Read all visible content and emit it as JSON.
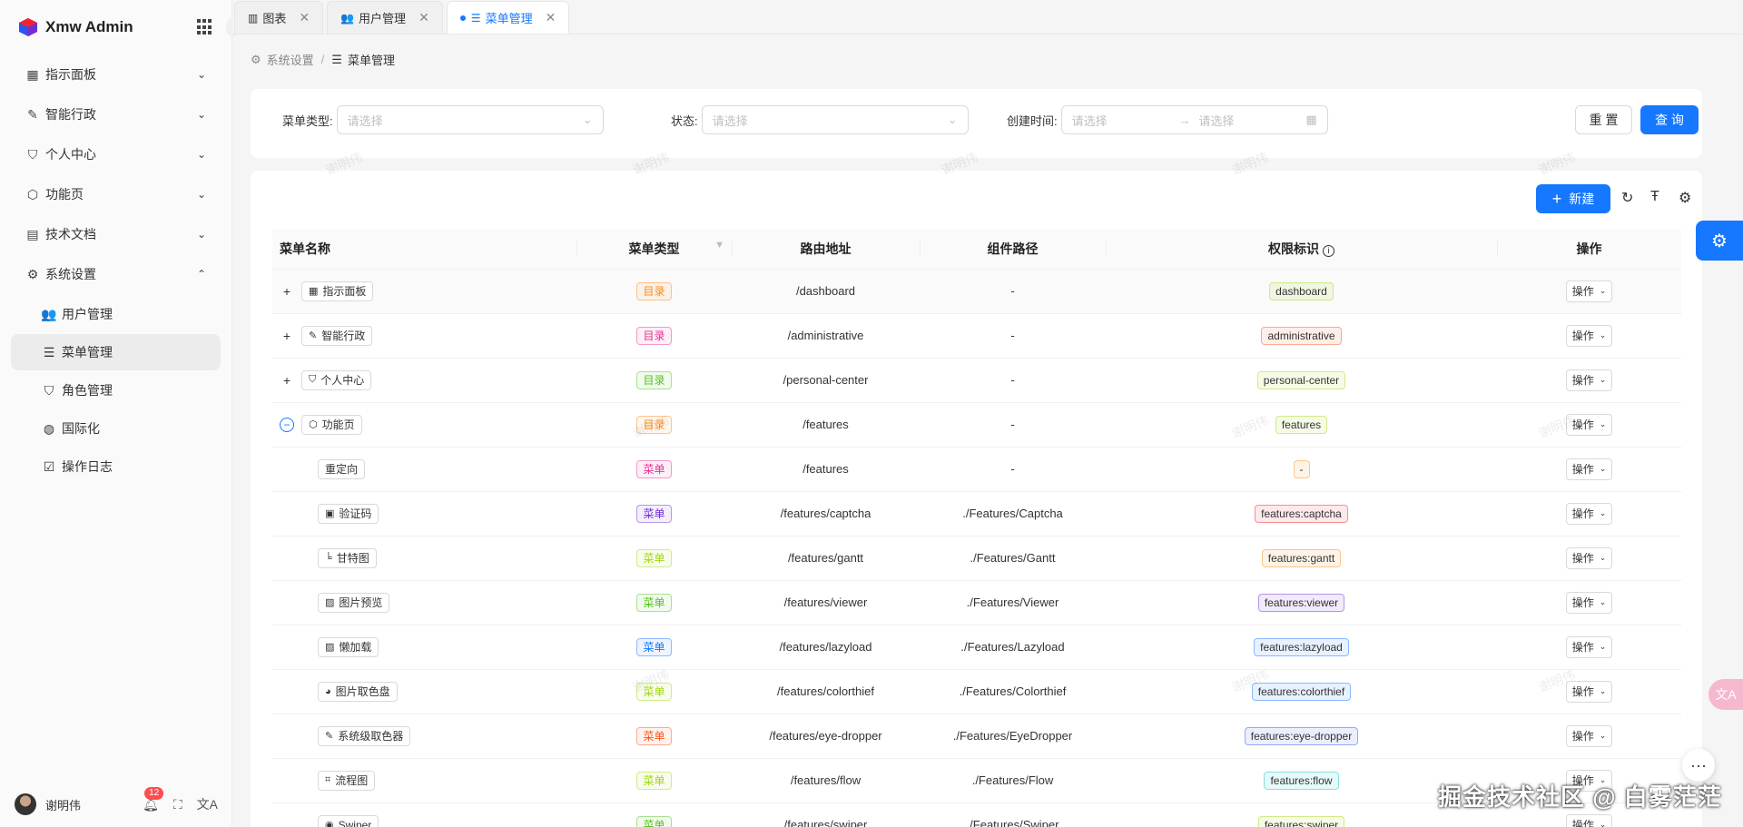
{
  "app": {
    "title": "Xmw Admin"
  },
  "sidebar": {
    "items": [
      {
        "label": "指示面板",
        "icon": "dashboard-icon",
        "glyph": "▦",
        "expanded": false
      },
      {
        "label": "智能行政",
        "icon": "feather-icon",
        "glyph": "✎",
        "expanded": false
      },
      {
        "label": "个人中心",
        "icon": "shield-user-icon",
        "glyph": "⛉",
        "expanded": false
      },
      {
        "label": "功能页",
        "icon": "cube-icon",
        "glyph": "⬡",
        "expanded": false
      },
      {
        "label": "技术文档",
        "icon": "document-icon",
        "glyph": "▤",
        "expanded": false
      },
      {
        "label": "系统设置",
        "icon": "settings-icon",
        "glyph": "⚙",
        "expanded": true
      }
    ],
    "sub_items": [
      {
        "label": "用户管理",
        "icon": "users-icon",
        "glyph": "👥",
        "active": false
      },
      {
        "label": "菜单管理",
        "icon": "menu-icon",
        "glyph": "☰",
        "active": true
      },
      {
        "label": "角色管理",
        "icon": "role-icon",
        "glyph": "⛉",
        "active": false
      },
      {
        "label": "国际化",
        "icon": "globe-icon",
        "glyph": "◍",
        "active": false
      },
      {
        "label": "操作日志",
        "icon": "log-icon",
        "glyph": "☑",
        "active": false
      }
    ],
    "footer": {
      "user_name": "谢明伟",
      "notification_count": "12"
    }
  },
  "tabs": [
    {
      "label": "图表",
      "glyph": "▥",
      "active": false
    },
    {
      "label": "用户管理",
      "glyph": "👥",
      "active": false
    },
    {
      "label": "菜单管理",
      "glyph": "☰",
      "active": true
    }
  ],
  "breadcrumb": {
    "parent": "系统设置",
    "current": "菜单管理"
  },
  "filters": {
    "menu_type_label": "菜单类型:",
    "menu_type_placeholder": "请选择",
    "status_label": "状态:",
    "status_placeholder": "请选择",
    "created_label": "创建时间:",
    "start_placeholder": "请选择",
    "end_placeholder": "请选择",
    "reset_label": "重 置",
    "query_label": "查 询"
  },
  "toolbar": {
    "new_label": "新建"
  },
  "table": {
    "columns": [
      "菜单名称",
      "菜单类型",
      "路由地址",
      "组件路径",
      "权限标识",
      "操作"
    ],
    "rows": [
      {
        "name": "指示面板",
        "glyph": "▦",
        "expander": "+",
        "type": "目录",
        "typeColor": "#fa8c16",
        "route": "/dashboard",
        "component": "-",
        "perm": "dashboard",
        "permColor": "#a0d911",
        "hl": true
      },
      {
        "name": "智能行政",
        "glyph": "✎",
        "expander": "+",
        "type": "目录",
        "typeColor": "#eb2f96",
        "route": "/administrative",
        "component": "-",
        "perm": "administrative",
        "permColor": "#fa541c"
      },
      {
        "name": "个人中心",
        "glyph": "⛉",
        "expander": "+",
        "type": "目录",
        "typeColor": "#52c41a",
        "route": "/personal-center",
        "component": "-",
        "perm": "personal-center",
        "permColor": "#a0d911"
      },
      {
        "name": "功能页",
        "glyph": "⬡",
        "expander": "−",
        "type": "目录",
        "typeColor": "#fa8c16",
        "route": "/features",
        "component": "-",
        "perm": "features",
        "permColor": "#a0d911"
      },
      {
        "name": "重定向",
        "glyph": "",
        "child": true,
        "type": "菜单",
        "typeColor": "#eb2f96",
        "route": "/features",
        "component": "-",
        "perm": "-",
        "permColor": "#fa8c16"
      },
      {
        "name": "验证码",
        "glyph": "▣",
        "child": true,
        "type": "菜单",
        "typeColor": "#722ed1",
        "route": "/features/captcha",
        "component": "./Features/Captcha",
        "perm": "features:captcha",
        "permColor": "#f5222d"
      },
      {
        "name": "甘特图",
        "glyph": "╘",
        "child": true,
        "type": "菜单",
        "typeColor": "#a0d911",
        "route": "/features/gantt",
        "component": "./Features/Gantt",
        "perm": "features:gantt",
        "permColor": "#fa8c16"
      },
      {
        "name": "图片预览",
        "glyph": "▨",
        "child": true,
        "type": "菜单",
        "typeColor": "#52c41a",
        "route": "/features/viewer",
        "component": "./Features/Viewer",
        "perm": "features:viewer",
        "permColor": "#722ed1"
      },
      {
        "name": "懒加载",
        "glyph": "▨",
        "child": true,
        "type": "菜单",
        "typeColor": "#1677ff",
        "route": "/features/lazyload",
        "component": "./Features/Lazyload",
        "perm": "features:lazyload",
        "permColor": "#1677ff"
      },
      {
        "name": "图片取色盘",
        "glyph": "◕",
        "child": true,
        "type": "菜单",
        "typeColor": "#a0d911",
        "route": "/features/colorthief",
        "component": "./Features/Colorthief",
        "perm": "features:colorthief",
        "permColor": "#1677ff"
      },
      {
        "name": "系统级取色器",
        "glyph": "✎",
        "child": true,
        "type": "菜单",
        "typeColor": "#fa541c",
        "route": "/features/eye-dropper",
        "component": "./Features/EyeDropper",
        "perm": "features:eye-dropper",
        "permColor": "#2f54eb"
      },
      {
        "name": "流程图",
        "glyph": "⌗",
        "child": true,
        "type": "菜单",
        "typeColor": "#a0d911",
        "route": "/features/flow",
        "component": "./Features/Flow",
        "perm": "features:flow",
        "permColor": "#13c2c2"
      },
      {
        "name": "Swiper",
        "glyph": "◉",
        "child": true,
        "type": "菜单",
        "typeColor": "#52c41a",
        "route": "/features/swiper",
        "component": "./Features/Swiper",
        "perm": "features:swiper",
        "permColor": "#a0d911"
      }
    ],
    "action_label": "操作"
  },
  "watermark_text": "谢明伟",
  "site_watermark": "掘金技术社区 @ 白雾茫茫"
}
